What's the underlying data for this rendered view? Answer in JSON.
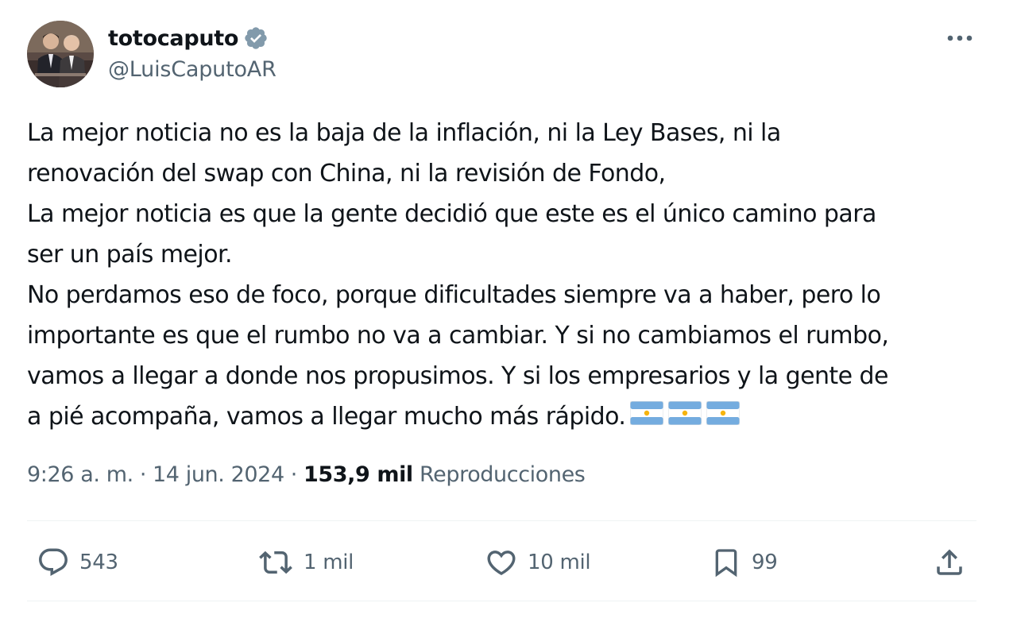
{
  "author": {
    "display_name": "totocaputo",
    "handle": "@LuisCaputoAR",
    "verified_icon": "verified-badge-icon",
    "avatar": "avatar-photo"
  },
  "tweet": {
    "lines": [
      "La mejor noticia no es la baja de la inflación, ni la Ley Bases, ni la",
      "renovación del swap con China, ni la revisión de Fondo,",
      "La mejor noticia es que la gente decidió que este es el único camino para",
      "ser un país mejor.",
      "No perdamos eso de foco, porque dificultades siempre va a haber, pero lo",
      "importante es que el rumbo no va a cambiar. Y si no cambiamos el rumbo,",
      "vamos a llegar a donde nos propusimos. Y si los empresarios y la gente de",
      "a pié acompaña, vamos a llegar mucho más rápido."
    ],
    "emojis": [
      "argentina-flag-icon",
      "argentina-flag-icon",
      "argentina-flag-icon"
    ]
  },
  "meta": {
    "time": "9:26 a. m.",
    "separator": "·",
    "date": "14 jun. 2024",
    "views_count": "153,9 mil",
    "views_label": "Reproducciones"
  },
  "actions": {
    "reply": {
      "icon": "reply-icon",
      "count": "543"
    },
    "retweet": {
      "icon": "retweet-icon",
      "count": "1 mil"
    },
    "like": {
      "icon": "heart-icon",
      "count": "10 mil"
    },
    "bookmark": {
      "icon": "bookmark-icon",
      "count": "99"
    },
    "share": {
      "icon": "share-icon"
    }
  },
  "more_icon": "more-options-icon",
  "colors": {
    "text": "#0f1419",
    "secondary": "#536471",
    "verified": "#829aab",
    "divider": "#eff3f4",
    "flag_blue": "#74acdf",
    "flag_sun": "#f6b40e"
  }
}
